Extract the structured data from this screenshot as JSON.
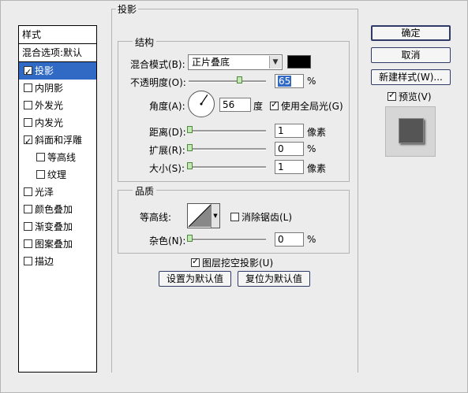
{
  "styles_panel": {
    "header": "样式",
    "blend_options": "混合选项:默认",
    "items": [
      {
        "label": "投影",
        "checked": true,
        "selected": true,
        "indent": false
      },
      {
        "label": "内阴影",
        "checked": false,
        "selected": false,
        "indent": false
      },
      {
        "label": "外发光",
        "checked": false,
        "selected": false,
        "indent": false
      },
      {
        "label": "内发光",
        "checked": false,
        "selected": false,
        "indent": false
      },
      {
        "label": "斜面和浮雕",
        "checked": true,
        "selected": false,
        "indent": false
      },
      {
        "label": "等高线",
        "checked": false,
        "selected": false,
        "indent": true
      },
      {
        "label": "纹理",
        "checked": false,
        "selected": false,
        "indent": true
      },
      {
        "label": "光泽",
        "checked": false,
        "selected": false,
        "indent": false
      },
      {
        "label": "颜色叠加",
        "checked": false,
        "selected": false,
        "indent": false
      },
      {
        "label": "渐变叠加",
        "checked": false,
        "selected": false,
        "indent": false
      },
      {
        "label": "图案叠加",
        "checked": false,
        "selected": false,
        "indent": false
      },
      {
        "label": "描边",
        "checked": false,
        "selected": false,
        "indent": false
      }
    ]
  },
  "drop_shadow": {
    "title": "投影",
    "structure": {
      "title": "结构",
      "blend_mode_label": "混合模式(B):",
      "blend_mode_value": "正片叠底",
      "shadow_color": "#000000",
      "opacity_label": "不透明度(O):",
      "opacity_value": "65",
      "opacity_unit": "%",
      "opacity_fraction": 0.65,
      "angle_label": "角度(A):",
      "angle_value": "56",
      "angle_unit": "度",
      "global_light_label": "使用全局光(G)",
      "global_light_checked": true,
      "distance_label": "距离(D):",
      "distance_value": "1",
      "distance_unit": "像素",
      "spread_label": "扩展(R):",
      "spread_value": "0",
      "spread_unit": "%",
      "size_label": "大小(S):",
      "size_value": "1",
      "size_unit": "像素"
    },
    "quality": {
      "title": "品质",
      "contour_label": "等高线:",
      "anti_alias_label": "消除锯齿(L)",
      "anti_alias_checked": false,
      "noise_label": "杂色(N):",
      "noise_value": "0",
      "noise_unit": "%"
    },
    "knockout_label": "图层挖空投影(U)",
    "knockout_checked": true,
    "make_default_label": "设置为默认值",
    "reset_default_label": "复位为默认值"
  },
  "buttons": {
    "ok": "确定",
    "cancel": "取消",
    "new_style": "新建样式(W)...",
    "preview_label": "预览(V)",
    "preview_checked": true
  },
  "colors": {
    "selection": "#316ac5",
    "slider_thumb": "#c5e6b5"
  }
}
